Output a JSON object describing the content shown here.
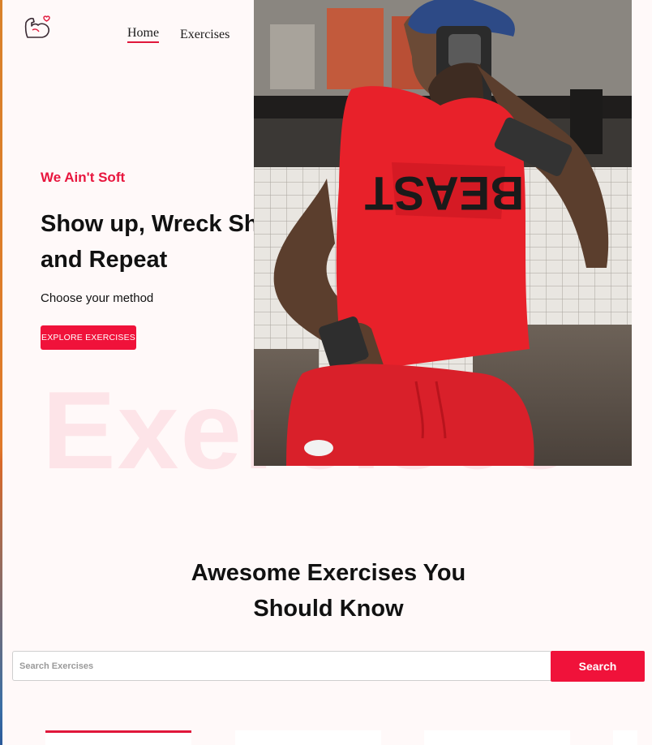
{
  "navbar": {
    "logo": "flexed-arm-heart-icon",
    "links": [
      {
        "label": "Home",
        "active": true
      },
      {
        "label": "Exercises",
        "active": false
      }
    ],
    "active_color": "#e0173b"
  },
  "hero": {
    "tagline": "We Ain't Soft",
    "headline": "Show up, Wreck Shit and Repeat",
    "subtitle": "Choose your method",
    "button_label": "EXPLORE EXERCISES",
    "watermark": "Exercises",
    "image": "gym-mirror-selfie-photo"
  },
  "exercises_section": {
    "title": "Awesome Exercises You Should Know",
    "search": {
      "placeholder": "Search Exercises",
      "value": "",
      "button_label": "Search"
    }
  },
  "colors": {
    "accent": "#f0123a",
    "background": "#fff9f9",
    "watermark": "#fde4e8"
  }
}
